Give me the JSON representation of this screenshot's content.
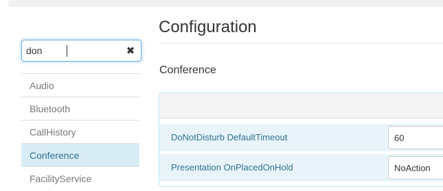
{
  "sidebar": {
    "search": {
      "value": "don"
    },
    "items": [
      {
        "label": "Audio",
        "active": false
      },
      {
        "label": "Bluetooth",
        "active": false
      },
      {
        "label": "CallHistory",
        "active": false
      },
      {
        "label": "Conference",
        "active": true
      },
      {
        "label": "FacilityService",
        "active": false
      }
    ]
  },
  "main": {
    "title": "Configuration",
    "section_title": "Conference",
    "settings": [
      {
        "label": "DoNotDisturb DefaultTimeout",
        "value": "60"
      },
      {
        "label": "Presentation OnPlacedOnHold",
        "value": "NoAction"
      }
    ]
  },
  "colors": {
    "active_bg": "#d9edf7",
    "active_text": "#31708f",
    "label_text": "#31708f",
    "focus_border": "#66afe9"
  },
  "icons": {
    "clear": "close-icon"
  }
}
